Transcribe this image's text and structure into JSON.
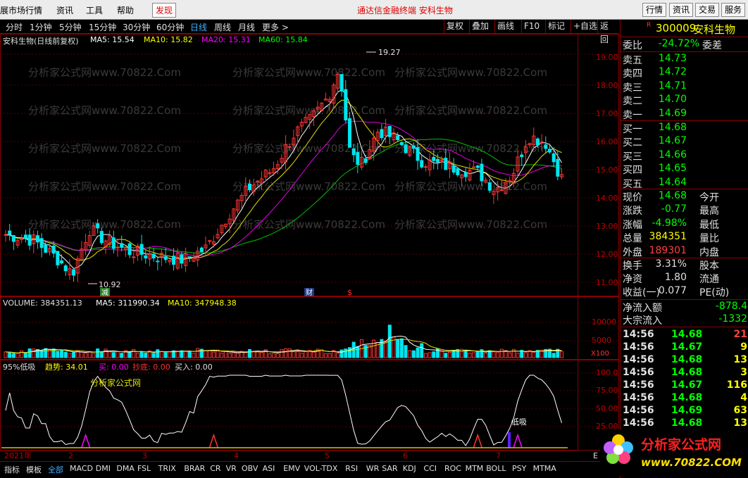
{
  "menubar": {
    "items": [
      "展市场行情",
      "资讯",
      "工具",
      "帮助"
    ],
    "discover": "发现",
    "banner": "通达信金融终端   安科生物",
    "right_buttons": [
      "行情",
      "资讯",
      "交易",
      "服务"
    ]
  },
  "toolbar": {
    "periods": [
      "分时",
      "1分钟",
      "5分钟",
      "15分钟",
      "30分钟",
      "60分钟",
      "日线",
      "周线",
      "月线",
      "更多 >"
    ],
    "active_period": "日线",
    "buttons": [
      "复权",
      "叠加",
      "画线",
      "F10",
      "标记",
      "+自选",
      "返回"
    ]
  },
  "main_chart": {
    "title": "安科生物(日线前复权)",
    "ma": [
      {
        "label": "MA5: 15.54",
        "color": "#ffffff"
      },
      {
        "label": "MA10: 15.82",
        "color": "#ffff00"
      },
      {
        "label": "MA20: 15.31",
        "color": "#ff00ff"
      },
      {
        "label": "MA60: 15.84",
        "color": "#00ff00"
      }
    ],
    "high_label": "19.27",
    "low_label": "10.92",
    "price_ticks": [
      "19.00",
      "18.00",
      "17.00",
      "16.00",
      "15.00",
      "14.00",
      "13.00",
      "12.00",
      "11.00"
    ],
    "markers": [
      "减",
      "财",
      "$"
    ]
  },
  "volume_chart": {
    "title": "VOLUME: 384351.13",
    "ma5": "MA5: 311990.34",
    "ma10": "MA10: 347948.38",
    "ticks": [
      "10000",
      "5000"
    ],
    "unit": "X100"
  },
  "indicator": {
    "name": "95%低吸",
    "trend": "趋势: 34.01",
    "buy": "买: 0.00",
    "bottom": "抄底: 0.00",
    "buyin": "买入: 0.00",
    "watermark": "分析家公式网",
    "label_low": "低吸",
    "ticks": [
      "100.0",
      "75.00",
      "50.00",
      "25.00"
    ]
  },
  "timeline": {
    "year": "2021年",
    "months": [
      "2",
      "3",
      "4",
      "5",
      "6",
      "7"
    ],
    "right_label": "E"
  },
  "watermark": "分析家公式网www.70822.Com",
  "stock": {
    "code": "300009",
    "name": "安科生物",
    "r_label": "R"
  },
  "quote": {
    "ratio": {
      "k": "委比",
      "v": "-24.72%",
      "k2": "委差"
    },
    "sells": [
      {
        "k": "卖五",
        "v": "14.73"
      },
      {
        "k": "卖四",
        "v": "14.72"
      },
      {
        "k": "卖三",
        "v": "14.71"
      },
      {
        "k": "卖二",
        "v": "14.70"
      },
      {
        "k": "卖一",
        "v": "14.69"
      }
    ],
    "buys": [
      {
        "k": "买一",
        "v": "14.68"
      },
      {
        "k": "买二",
        "v": "14.67"
      },
      {
        "k": "买三",
        "v": "14.66"
      },
      {
        "k": "买四",
        "v": "14.65"
      },
      {
        "k": "买五",
        "v": "14.64"
      }
    ],
    "stats": [
      {
        "k": "现价",
        "v": "14.68",
        "c": "#00ff00",
        "k2": "今开"
      },
      {
        "k": "涨跌",
        "v": "-0.77",
        "c": "#00ff00",
        "k2": "最高"
      },
      {
        "k": "涨幅",
        "v": "-4.98%",
        "c": "#00ff00",
        "k2": "最低"
      },
      {
        "k": "总量",
        "v": "384351",
        "c": "#ffff00",
        "k2": "量比"
      },
      {
        "k": "外盘",
        "v": "189301",
        "c": "#ff4040",
        "k2": "内盘"
      }
    ],
    "stats2": [
      {
        "k": "换手",
        "v": "3.31%",
        "k2": "股本"
      },
      {
        "k": "净资",
        "v": "1.80",
        "k2": "流通"
      },
      {
        "k": "收益(一)",
        "v": "0.077",
        "k2": "PE(动)"
      }
    ],
    "flow": [
      {
        "k": "净流入额",
        "v": "-878.4"
      },
      {
        "k": "大宗流入",
        "v": "-1332"
      }
    ],
    "ticks": [
      {
        "t": "14:56",
        "p": "14.68",
        "n": "21",
        "c": "#ff4040"
      },
      {
        "t": "14:56",
        "p": "14.67",
        "n": "9",
        "c": "#ffff00"
      },
      {
        "t": "14:56",
        "p": "14.68",
        "n": "13",
        "c": "#ffff00"
      },
      {
        "t": "14:56",
        "p": "14.68",
        "n": "3",
        "c": "#ffff00"
      },
      {
        "t": "14:56",
        "p": "14.67",
        "n": "116",
        "c": "#ffff00"
      },
      {
        "t": "14:56",
        "p": "14.68",
        "n": "4",
        "c": "#ffff00"
      },
      {
        "t": "14:56",
        "p": "14.69",
        "n": "63",
        "c": "#ffff00"
      },
      {
        "t": "14:56",
        "p": "14.68",
        "n": "13",
        "c": "#ffff00"
      }
    ]
  },
  "bottombar": {
    "items": [
      "指标",
      "模板",
      "全部",
      "MACD",
      "DMI",
      "DMA",
      "FSL",
      "TRIX",
      "BRAR",
      "CR",
      "VR",
      "OBV",
      "ASI",
      "EMV",
      "VOL-TDX",
      "RSI",
      "WR",
      "SAR",
      "KDJ",
      "CCI",
      "ROC",
      "MTM",
      "BOLL",
      "PSY",
      "MTMA"
    ]
  },
  "logo": {
    "text": "分析家公式网",
    "url": "www.70822.COM"
  },
  "colors": {
    "up": "#ff3333",
    "down": "#00e5ee",
    "bg": "#000000",
    "grid": "#8b0000"
  }
}
